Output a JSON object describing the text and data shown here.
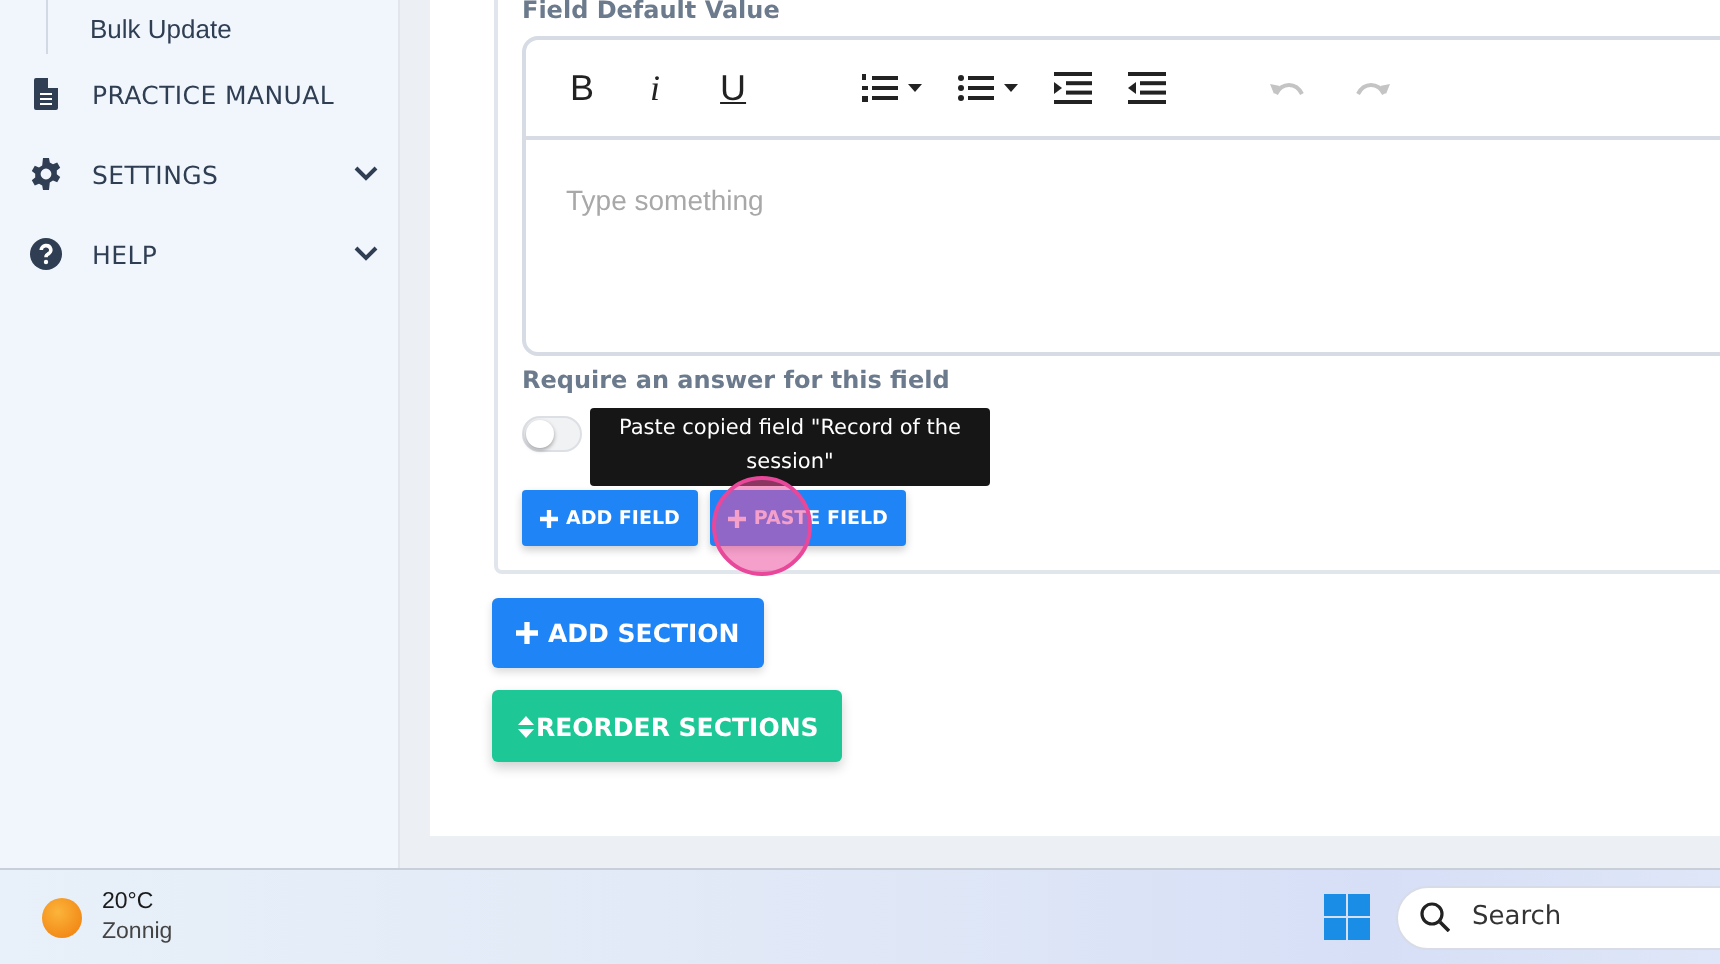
{
  "sidebar": {
    "items": [
      {
        "kind": "sub",
        "label": "Bulk Update"
      },
      {
        "kind": "main",
        "label": "PRACTICE MANUAL"
      },
      {
        "kind": "main",
        "label": "SETTINGS",
        "expanded": false
      },
      {
        "kind": "main",
        "label": "HELP",
        "expanded": false
      }
    ]
  },
  "field_card": {
    "default_value_label": "Field Default Value",
    "editor": {
      "toolbar": [
        {
          "kind": "bold",
          "label": "B",
          "disabled": false
        },
        {
          "kind": "italic",
          "label": "i",
          "disabled": false
        },
        {
          "kind": "underline",
          "label": "U",
          "disabled": false
        },
        {
          "kind": "ordered-list",
          "disabled": false
        },
        {
          "kind": "bullet-list",
          "disabled": false
        },
        {
          "kind": "indent",
          "disabled": false
        },
        {
          "kind": "outdent",
          "disabled": false
        },
        {
          "kind": "undo",
          "disabled": true
        },
        {
          "kind": "redo",
          "disabled": true
        }
      ],
      "placeholder": "Type something"
    },
    "require_label": "Require an answer for this field",
    "require_toggle": {
      "on": false
    },
    "buttons": [
      "ADD FIELD",
      "PASTE FIELD"
    ],
    "tooltip": "Paste copied field \"Record of the session\""
  },
  "add_section": "ADD SECTION",
  "reorder_sections": "REORDER SECTIONS",
  "taskbar": {
    "temperature": "20°C",
    "weather": "Zonnig",
    "search_placeholder": "Search"
  }
}
